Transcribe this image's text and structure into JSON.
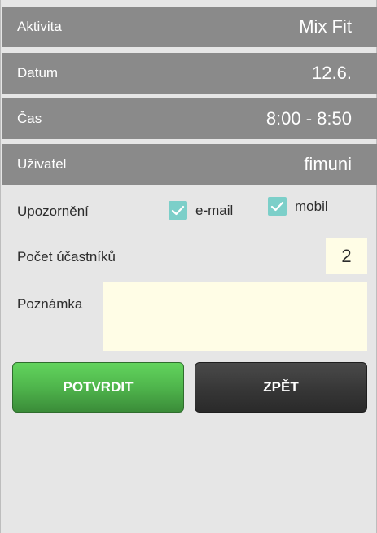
{
  "info": {
    "activity": {
      "label": "Aktivita",
      "value": "Mix Fit"
    },
    "date": {
      "label": "Datum",
      "value": "12.6."
    },
    "time": {
      "label": "Čas",
      "value": "8:00 - 8:50"
    },
    "user": {
      "label": "Uživatel",
      "value": "fimuni"
    }
  },
  "form": {
    "notification_label": "Upozornění",
    "email_label": "e-mail",
    "email_checked": true,
    "mobile_label": "mobil",
    "mobile_checked": true,
    "participants_label": "Počet účastníků",
    "participants_value": "2",
    "note_label": "Poznámka",
    "note_value": ""
  },
  "buttons": {
    "confirm_label": "POTVRDIT",
    "back_label": "ZPĚT"
  },
  "colors": {
    "row_bg": "#8a8a8a",
    "checkbox": "#7ccfc9",
    "input_bg": "#fffde6",
    "confirm": "#4fb54c",
    "back": "#353535"
  },
  "icons": {
    "checkbox": "checkmark-icon"
  }
}
